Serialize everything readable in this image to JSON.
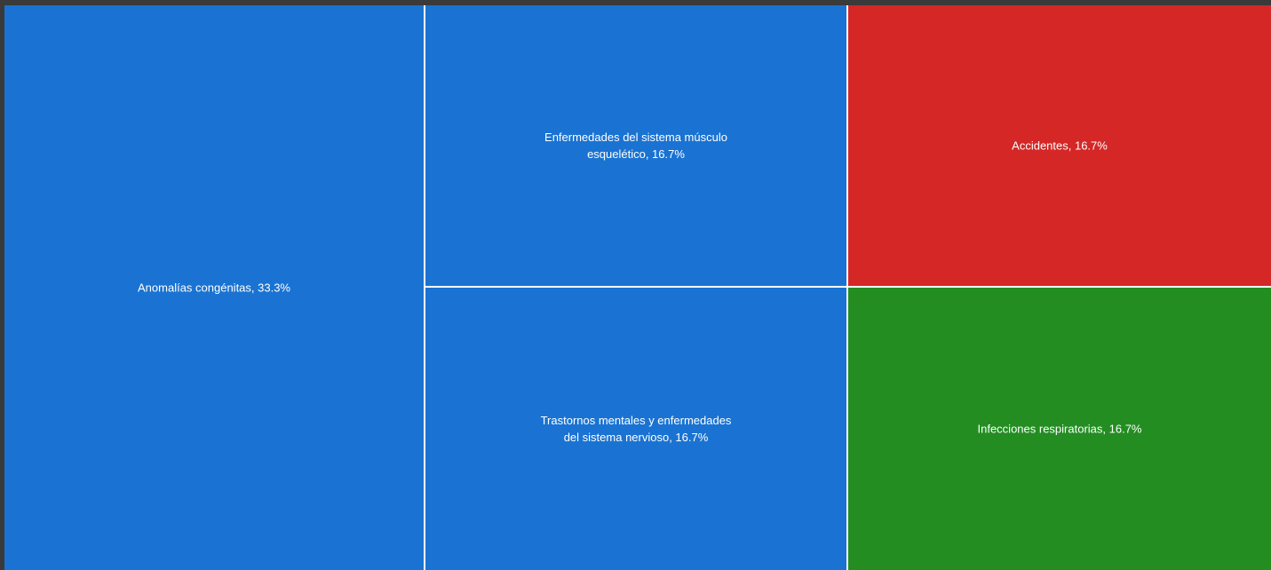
{
  "chart_data": {
    "type": "treemap",
    "items": [
      {
        "label": "Anomalías congénitas, 33.3%",
        "name": "Anomalías congénitas",
        "value": 33.3,
        "color": "#1a73d2"
      },
      {
        "label": "Enfermedades del sistema músculo esquelético, 16.7%",
        "name": "Enfermedades del sistema músculo esquelético",
        "value": 16.7,
        "color": "#1a73d2"
      },
      {
        "label": "Trastornos mentales y enfermedades del sistema nervioso, 16.7%",
        "name": "Trastornos mentales y enfermedades del sistema nervioso",
        "value": 16.7,
        "color": "#1a73d2"
      },
      {
        "label": "Accidentes, 16.7%",
        "name": "Accidentes",
        "value": 16.7,
        "color": "#d42726"
      },
      {
        "label": "Infecciones respiratorias, 16.7%",
        "name": "Infecciones respiratorias",
        "value": 16.7,
        "color": "#238d22"
      }
    ]
  }
}
